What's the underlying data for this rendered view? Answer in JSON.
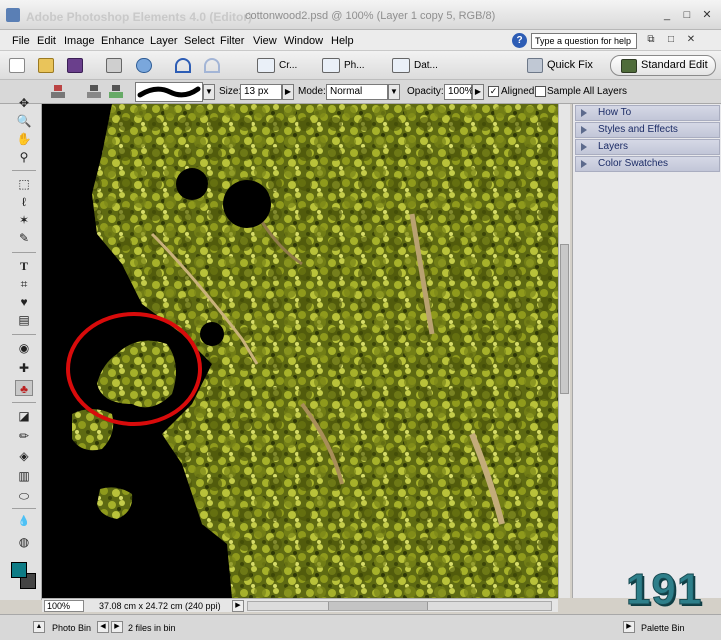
{
  "window": {
    "app_title": "Adobe Photoshop Elements 4.0 (Editor)",
    "doc_title": "cottonwood2.psd @ 100% (Layer 1 copy 5, RGB/8)",
    "min_glyph": "_",
    "max_glyph": "□",
    "close_glyph": "✕"
  },
  "menu": {
    "items": [
      "File",
      "Edit",
      "Image",
      "Enhance",
      "Layer",
      "Select",
      "Filter",
      "View",
      "Window",
      "Help"
    ],
    "help_placeholder": "Type a question for help",
    "help_glyph": "?"
  },
  "shortcuts": {
    "create_label": "Cr...",
    "photo_label": "Ph...",
    "date_label": "Dat...",
    "quick_fix_label": "Quick Fix",
    "standard_edit_label": "Standard Edit"
  },
  "options": {
    "size_label": "Size:",
    "size_value": "13 px",
    "mode_label": "Mode:",
    "mode_value": "Normal",
    "opacity_label": "Opacity:",
    "opacity_value": "100%",
    "aligned_label": "Aligned",
    "aligned_checked": true,
    "sample_all_label": "Sample All Layers",
    "sample_all_checked": false,
    "dropdown_glyph": "▼",
    "arrow_glyph": "▶",
    "check_glyph": "✓"
  },
  "tools": [
    {
      "name": "move-tool",
      "glyph": "✥"
    },
    {
      "name": "zoom-tool",
      "glyph": "🔍"
    },
    {
      "name": "hand-tool",
      "glyph": "✋"
    },
    {
      "name": "eyedropper-tool",
      "glyph": "⚲"
    },
    {
      "name": "marquee-tool",
      "glyph": "⬚"
    },
    {
      "name": "lasso-tool",
      "glyph": "ℓ"
    },
    {
      "name": "magic-wand-tool",
      "glyph": "✶"
    },
    {
      "name": "selection-brush-tool",
      "glyph": "✎"
    },
    {
      "name": "type-tool",
      "glyph": "T"
    },
    {
      "name": "crop-tool",
      "glyph": "⌗"
    },
    {
      "name": "cookie-cutter-tool",
      "glyph": "♥"
    },
    {
      "name": "straighten-tool",
      "glyph": "▤"
    },
    {
      "name": "red-eye-tool",
      "glyph": "◉"
    },
    {
      "name": "healing-brush-tool",
      "glyph": "✚"
    },
    {
      "name": "clone-stamp-tool",
      "glyph": "♣"
    },
    {
      "name": "eraser-tool",
      "glyph": "◪"
    },
    {
      "name": "pencil-tool",
      "glyph": "✏"
    },
    {
      "name": "paint-bucket-tool",
      "glyph": "◈"
    },
    {
      "name": "gradient-tool",
      "glyph": "▥"
    },
    {
      "name": "shape-tool",
      "glyph": "⬭"
    },
    {
      "name": "blur-tool",
      "glyph": "💧"
    },
    {
      "name": "sponge-tool",
      "glyph": "◍"
    }
  ],
  "palettes": [
    "How To",
    "Styles and Effects",
    "Layers",
    "Color Swatches"
  ],
  "status": {
    "zoom": "100%",
    "doc_info": "37.08 cm x 24.72 cm (240 ppi)"
  },
  "bottom": {
    "photo_bin_label": "Photo Bin",
    "files_label": "2 files in bin",
    "palette_bin_label": "Palette Bin",
    "up_glyph": "▲",
    "left_glyph": "◀",
    "right_glyph": "▶"
  },
  "overlay": {
    "page_number": "191"
  },
  "colors": {
    "foreground": "#0e7c86",
    "background": "#444444",
    "annotation_circle": "#d80b0b"
  }
}
